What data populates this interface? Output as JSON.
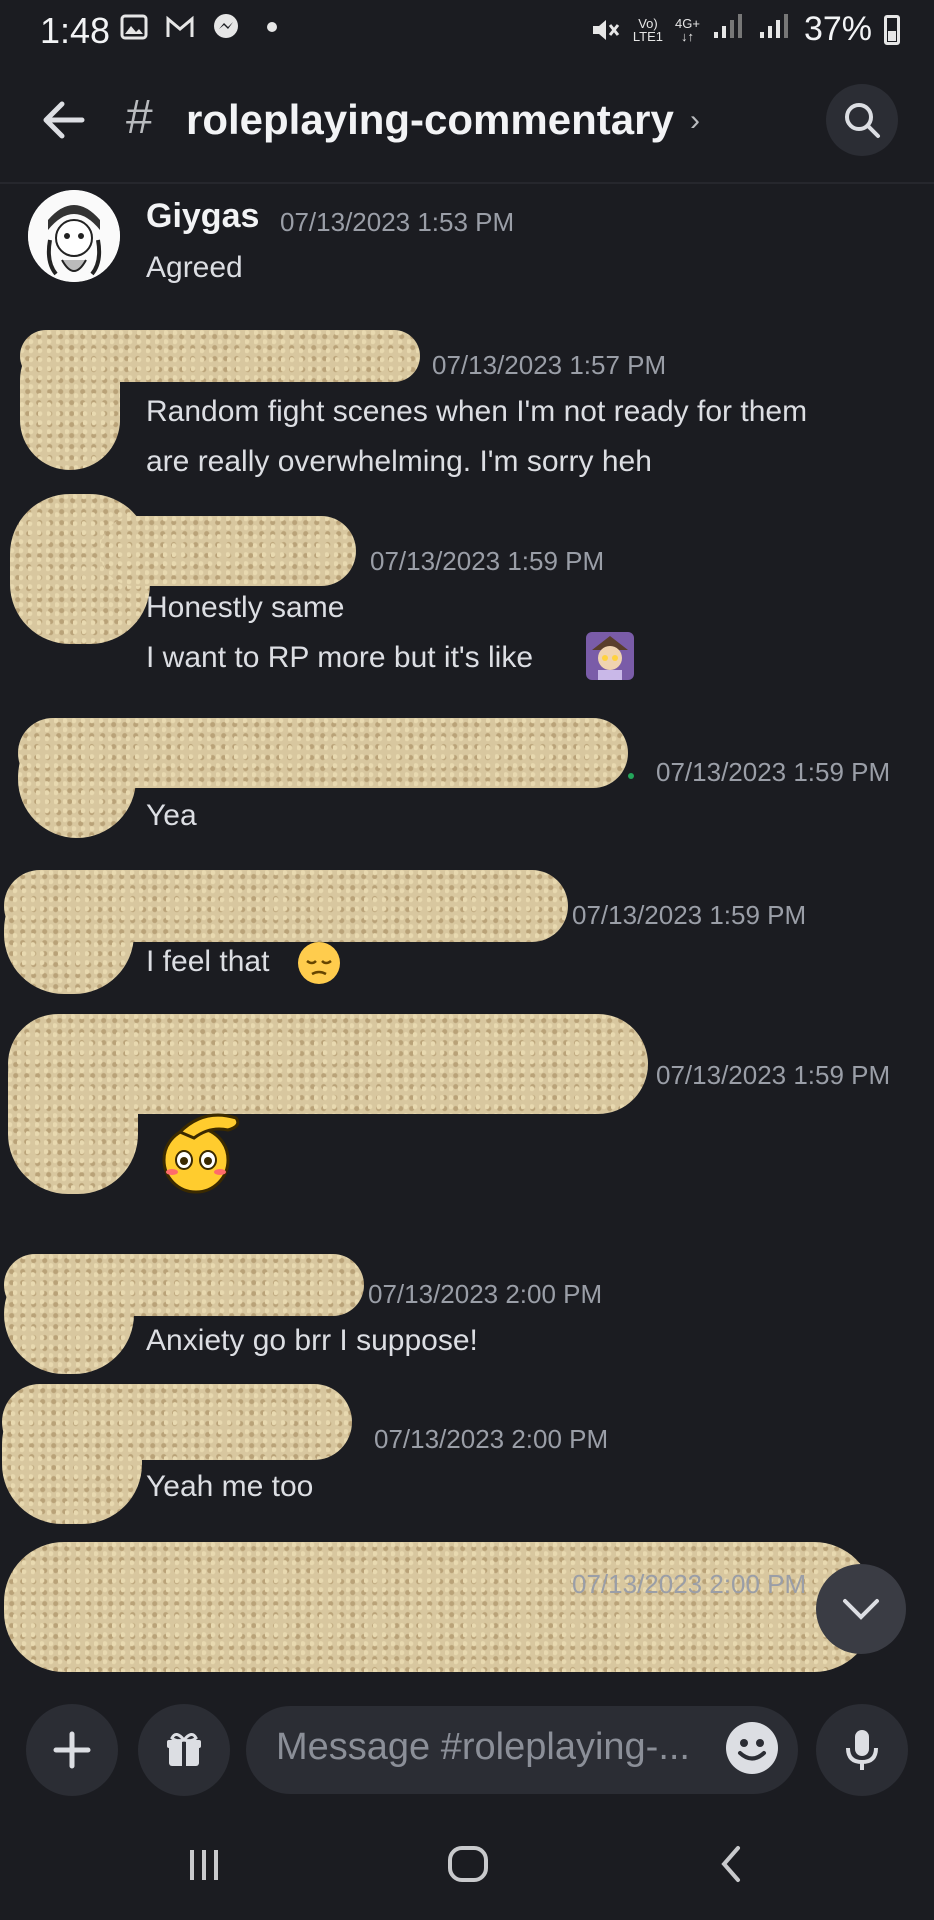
{
  "status_bar": {
    "time": "1:48",
    "battery": "37%",
    "network_top": "Vo)",
    "network_bottom": "LTE1",
    "network_gen": "4G+"
  },
  "header": {
    "hash": "#",
    "channel_name": "roleplaying-commentary",
    "chevron": "›"
  },
  "messages": [
    {
      "author": "Giygas",
      "timestamp": "07/13/2023 1:53 PM",
      "lines": [
        "Agreed"
      ]
    },
    {
      "author": "",
      "timestamp": "07/13/2023 1:57 PM",
      "lines": [
        "Random fight scenes when I'm not ready for them",
        "are really overwhelming. I'm sorry heh"
      ]
    },
    {
      "author": "",
      "timestamp": "07/13/2023 1:59 PM",
      "lines": [
        "Honestly same",
        "I want to RP more but it's like"
      ]
    },
    {
      "author": "",
      "timestamp": "07/13/2023 1:59 PM",
      "lines": [
        "Yea"
      ]
    },
    {
      "author": "",
      "timestamp": "07/13/2023 1:59 PM",
      "lines": [
        "I feel that"
      ]
    },
    {
      "author": "",
      "timestamp": "07/13/2023 1:59 PM",
      "lines": []
    },
    {
      "author": "",
      "timestamp": "07/13/2023 2:00 PM",
      "lines": [
        "Anxiety go brr I suppose!"
      ]
    },
    {
      "author": "",
      "timestamp": "07/13/2023 2:00 PM",
      "lines": [
        "Yeah me too"
      ]
    },
    {
      "author": "",
      "timestamp": "07/13/2023 2:00 PM",
      "lines": []
    }
  ],
  "composer": {
    "placeholder": "Message #roleplaying-..."
  },
  "colors": {
    "background": "#1b1c21",
    "surface": "#2b2d34",
    "text": "#dcdee3",
    "muted": "#9a9ea7",
    "redaction": "#d8c79f",
    "online": "#23a55a"
  },
  "icons": [
    "back-arrow-icon",
    "search-icon",
    "chevron-down-icon",
    "plus-icon",
    "gift-icon",
    "emoji-icon",
    "microphone-icon",
    "recents-nav-icon",
    "home-nav-icon",
    "back-nav-icon"
  ]
}
